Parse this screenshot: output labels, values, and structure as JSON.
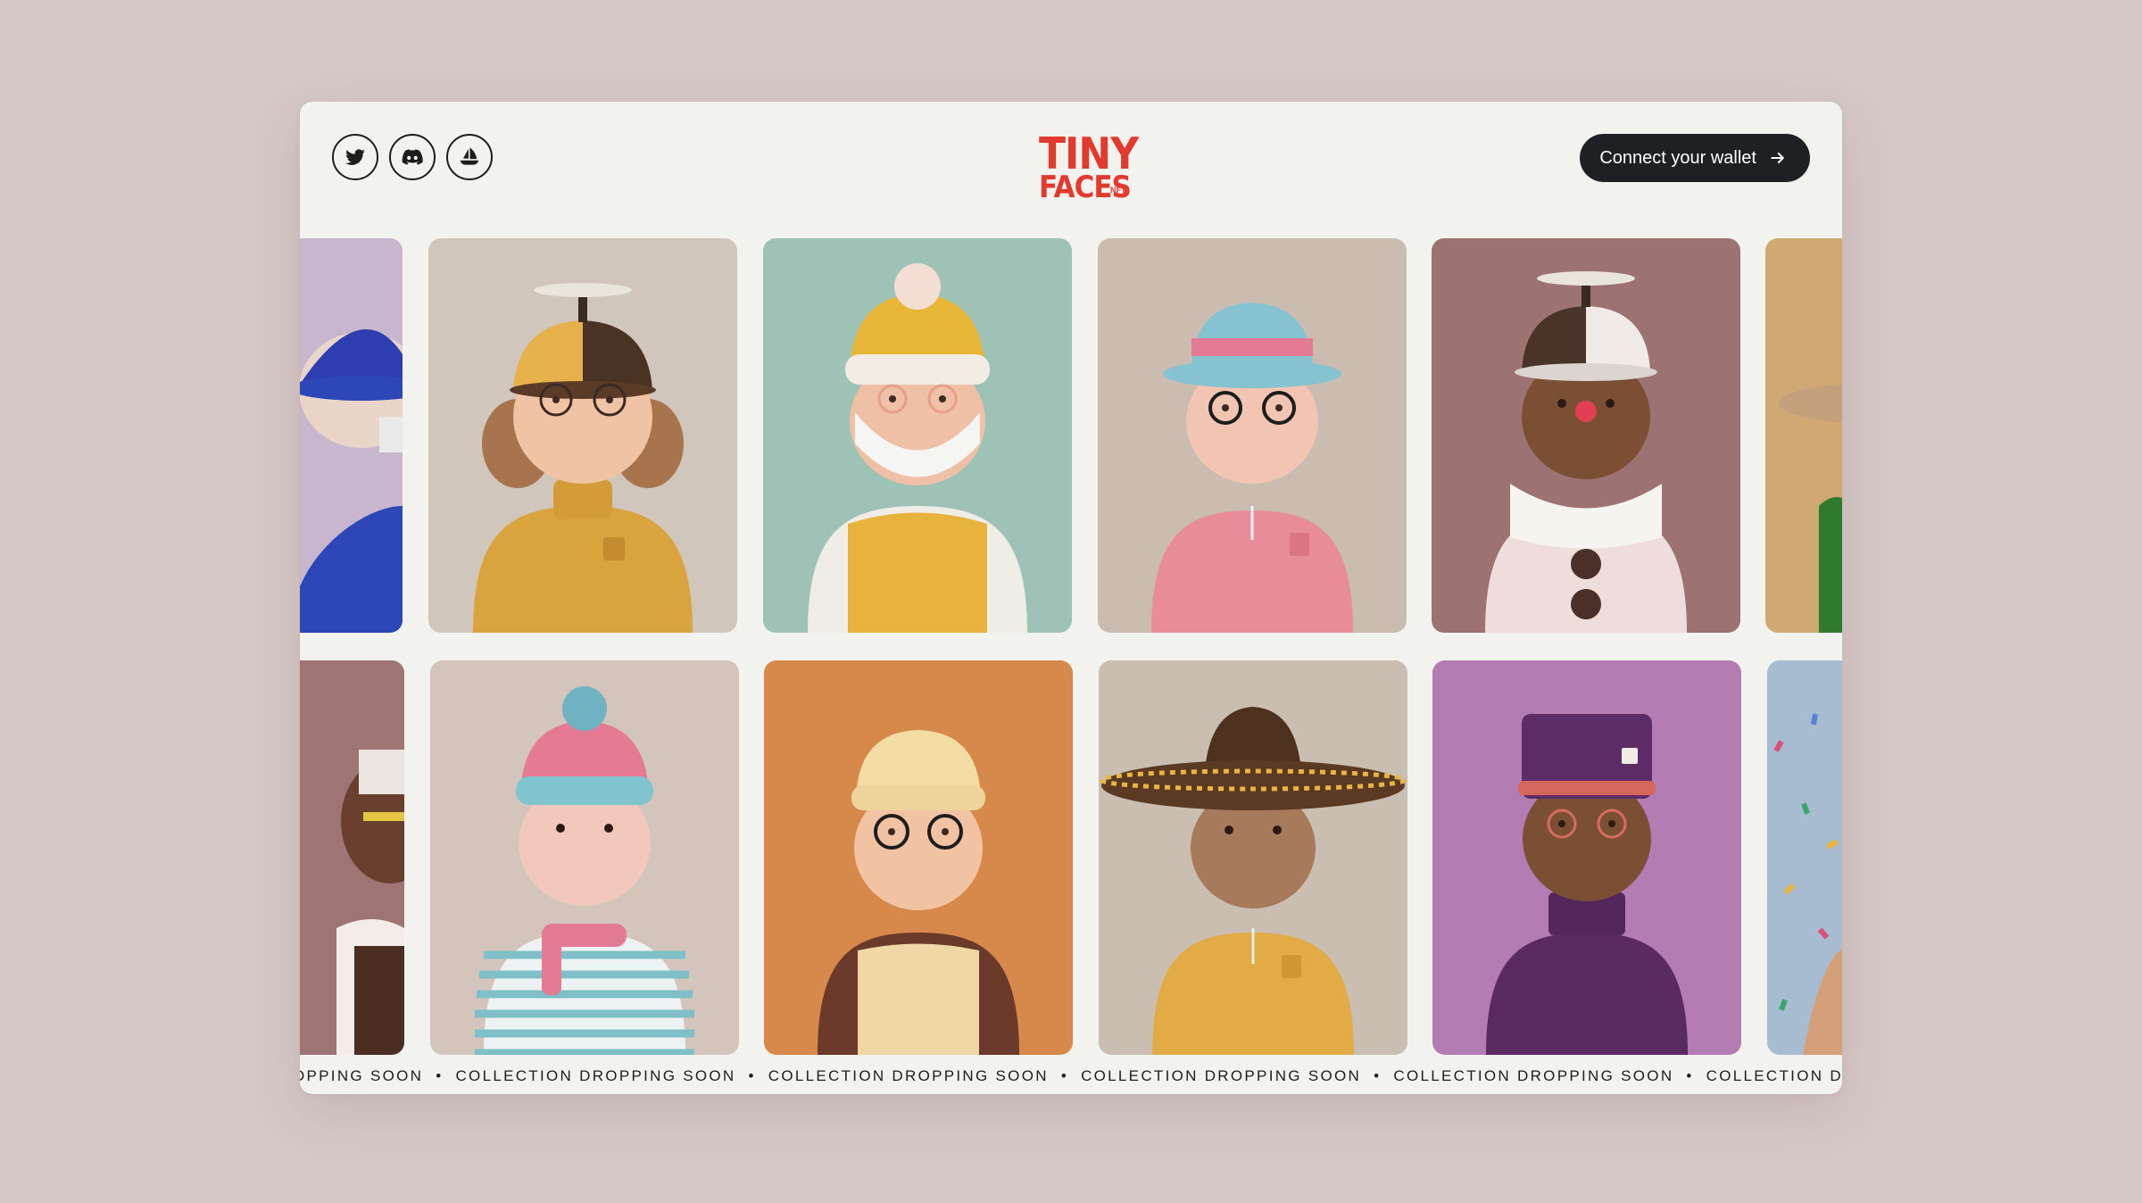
{
  "socials": [
    {
      "name": "twitter",
      "icon": "twitter-icon"
    },
    {
      "name": "discord",
      "icon": "discord-icon"
    },
    {
      "name": "opensea",
      "icon": "opensea-icon"
    }
  ],
  "logo": {
    "line1": "TINY",
    "line2": "FACES",
    "suffix": "NFT",
    "color": "#e23a2e"
  },
  "connect_button": {
    "label": "Connect your wallet",
    "icon": "arrow-right-icon"
  },
  "ticker": {
    "items": [
      "OPPING SOON",
      "COLLECTION DROPPING SOON",
      "COLLECTION DROPPING SOON",
      "COLLECTION DROPPING SOON",
      "COLLECTION DROPPING SOON",
      "COLLECTION DROPPING SOON"
    ],
    "separator": "•"
  },
  "colors": {
    "page_bg": "#d5c8c6",
    "window_bg": "#f2f2ee",
    "button_bg": "#1d2124",
    "accent": "#e23a2e"
  }
}
